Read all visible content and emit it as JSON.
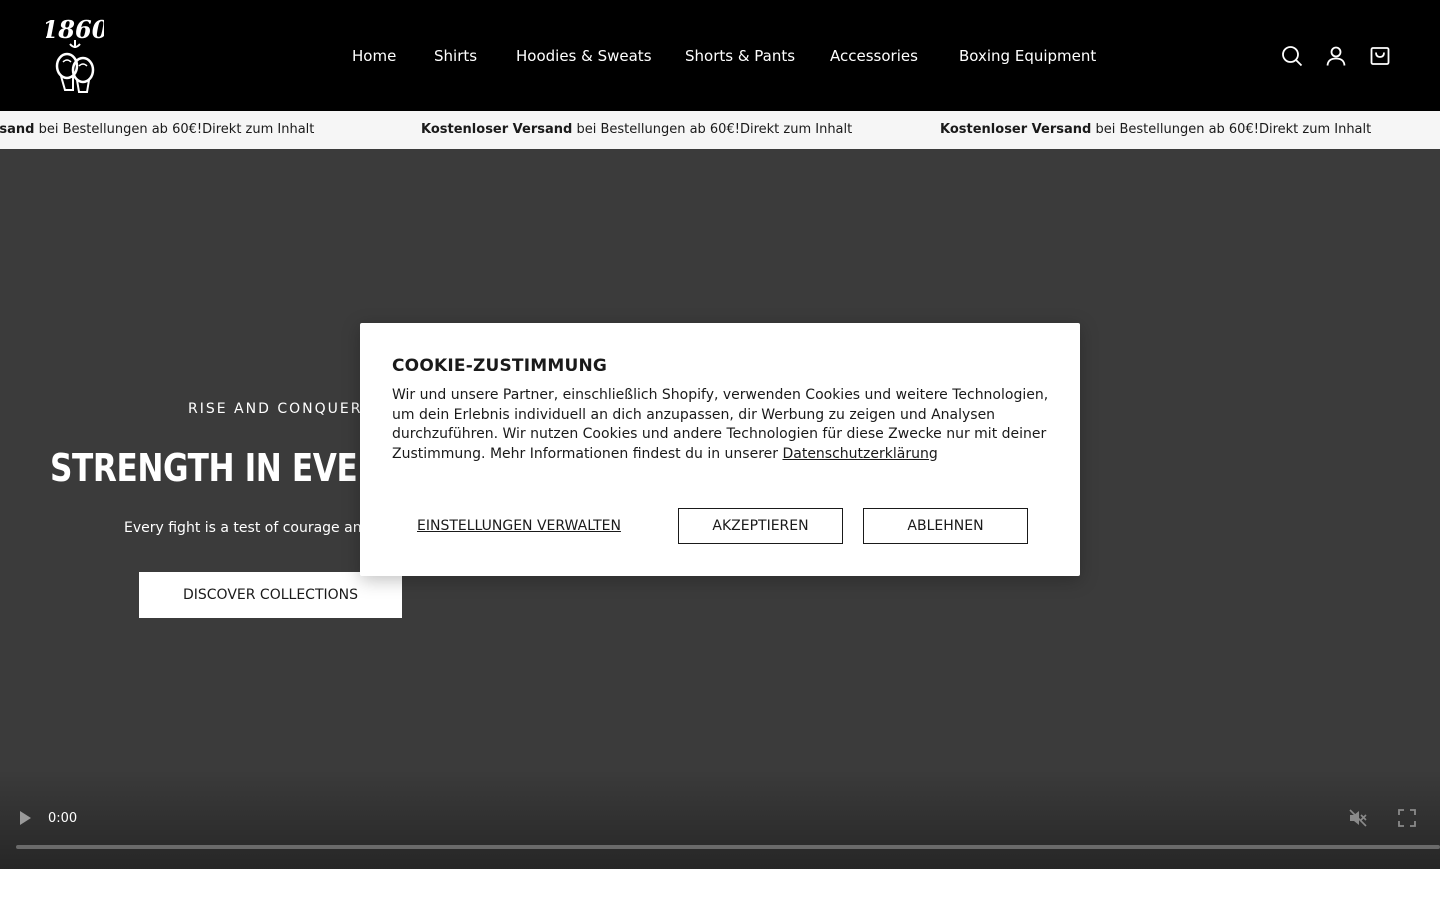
{
  "header": {
    "logo_text": "1860",
    "nav": [
      {
        "label": "Home"
      },
      {
        "label": "Shirts"
      },
      {
        "label": "Hoodies & Sweats"
      },
      {
        "label": "Shorts & Pants"
      },
      {
        "label": "Accessories"
      },
      {
        "label": "Boxing Equipment"
      }
    ],
    "icons": [
      "search-icon",
      "account-icon",
      "cart-icon"
    ]
  },
  "announcement": {
    "bold": "Kostenloser Versand",
    "bold_partial": "rsand",
    "text": " bei Bestellungen ab 60€!",
    "skip_link": "Direkt zum Inhalt"
  },
  "hero": {
    "kicker": "RISE AND CONQUER",
    "title": "STRENGTH IN EVERY",
    "subtitle": "Every fight is a test of courage an",
    "cta_label": "DISCOVER COLLECTIONS"
  },
  "video": {
    "time": "0:00",
    "progress_fraction": 0
  },
  "cookie": {
    "title": "COOKIE-ZUSTIMMUNG",
    "body": "Wir und unsere Partner, einschließlich Shopify, verwenden Cookies und weitere Technologien, um dein Erlebnis individuell an dich anzupassen, dir Werbung zu zeigen und Analysen durchzuführen. Wir nutzen Cookies und andere Technologien für diese Zwecke nur mit deiner Zustimmung. Mehr Informationen findest du in unserer ",
    "privacy_link": "Datenschutzerklärung",
    "manage_label": "EINSTELLUNGEN VERWALTEN",
    "accept_label": "AKZEPTIEREN",
    "decline_label": "ABLEHNEN"
  },
  "colors": {
    "header_bg": "#000000",
    "announcement_bg": "#f6f6f6",
    "hero_bg": "#3b3b3b",
    "text_dark": "#1a1a1a"
  }
}
